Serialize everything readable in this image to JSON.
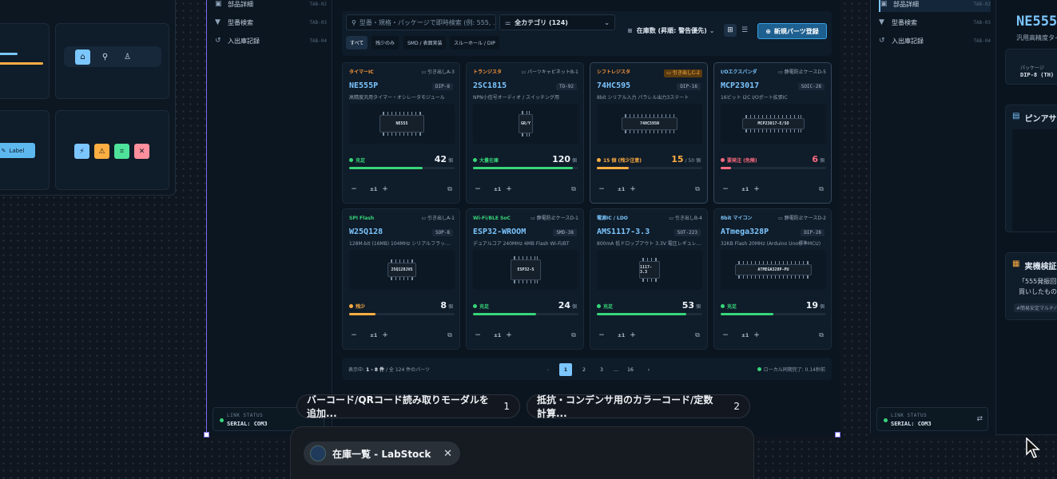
{
  "left_art": {
    "label_button": "Label"
  },
  "sidebar": {
    "items": [
      {
        "label": "部品詳細",
        "tag": "TAB-02"
      },
      {
        "label": "型番検索",
        "tag": "TAB-03"
      },
      {
        "label": "入出庫記録",
        "tag": "TAB-04"
      }
    ],
    "link_label": "LINK STATUS",
    "link_value": "SERIAL: COM3"
  },
  "toolbar": {
    "search_placeholder": "型番・規格・パッケージで即時検索 (例: 555, ...",
    "category": "全カテゴリ (124)",
    "chips": [
      "すべて",
      "残少のみ",
      "SMD / 表面実装",
      "スルーホール / DIP"
    ],
    "sort": "在庫数 (昇順: 警告優先)",
    "new_button": "新規パーツ登録"
  },
  "cards": [
    {
      "category": "タイマーIC",
      "cat_color": "#ff9a3c",
      "location": "引き出しA-3",
      "part": "NE555P",
      "package": "DIP-8",
      "desc": "高精度汎用タイマー・オシレータモジュール",
      "chip": "NE555",
      "status": "充足",
      "status_color": "#37d67a",
      "qty": "42",
      "max": "",
      "level": 0.7,
      "pm": "±1"
    },
    {
      "category": "トランジスタ",
      "cat_color": "#ff9a3c",
      "location": "パーツキャビネットB-1",
      "part": "2SC1815",
      "package": "TO-92",
      "desc": "NPN小信号オーディオ / スイッチング用",
      "chip": "GR/Y",
      "status": "大量在庫",
      "status_color": "#37d67a",
      "qty": "120",
      "max": "",
      "level": 0.95,
      "pm": "±1"
    },
    {
      "category": "シフトレジスタ",
      "cat_color": "#ff9a3c",
      "location": "引き出しC-2",
      "part": "74HC595",
      "package": "DIP-16",
      "desc": "8bit シリアル入力 パラレル出力3ステート",
      "chip": "74HC595N",
      "status": "15 個 (残少注意)",
      "status_color": "#ffae42",
      "qty": "15",
      "max": " / 50",
      "level": 0.3,
      "pm": "±1"
    },
    {
      "category": "I/Oエクスパンダ",
      "cat_color": "#7cc6ff",
      "location": "静電防止ケースD-5",
      "part": "MCP23017",
      "package": "SOIC-28",
      "desc": "16ビット I2C I/Oポート拡張IC",
      "chip": "MCP23017-E/SO",
      "status": "要発注 (危険)",
      "status_color": "#ff6b81",
      "qty": "6",
      "max": "",
      "level": 0.1,
      "pm": "±1"
    },
    {
      "category": "SPI Flash",
      "cat_color": "#37d67a",
      "location": "引き出しA-1",
      "part": "W25Q128",
      "package": "SOP-8",
      "desc": "128M-bit (16MB) 104MHz シリアルフラッシュ",
      "chip": "25Q128JVS",
      "status": "残少",
      "status_color": "#ffae42",
      "qty": "8",
      "max": "",
      "level": 0.25,
      "pm": "±1"
    },
    {
      "category": "Wi-Fi/BLE SoC",
      "cat_color": "#37d67a",
      "location": "静電防止ケースD-1",
      "part": "ESP32-WROOM",
      "package": "SMD-38",
      "desc": "デュアルコア 240MHz 4MB Flash Wi-Fi/BT",
      "chip": "ESP32-S",
      "status": "充足",
      "status_color": "#37d67a",
      "qty": "24",
      "max": "",
      "level": 0.6,
      "pm": "±1"
    },
    {
      "category": "電源IC / LDO",
      "cat_color": "#7cc6ff",
      "location": "引き出しB-4",
      "part": "AMS1117-3.3",
      "package": "SOT-223",
      "desc": "800mA 低ドロップアウト 3.3V 電圧レギュレータ",
      "chip": "1117-3.3",
      "status": "充足",
      "status_color": "#37d67a",
      "qty": "53",
      "max": "",
      "level": 0.85,
      "pm": "±1"
    },
    {
      "category": "8bit マイコン",
      "cat_color": "#7cc6ff",
      "location": "静電防止ケースD-2",
      "part": "ATmega328P",
      "package": "DIP-28",
      "desc": "32KB Flash 20MHz (Arduino Uno標準MCU)",
      "chip": "ATMEGA328P-PU",
      "status": "充足",
      "status_color": "#37d67a",
      "qty": "19",
      "max": "",
      "level": 0.5,
      "pm": "±1"
    }
  ],
  "pagination": {
    "prefix": "表示中:",
    "range": "1 - 8 件",
    "total": "/ 全 124 件のパーツ",
    "pages": [
      "1",
      "2",
      "3",
      "…",
      "16"
    ],
    "sync": "ローカル同期完了: 0.14秒前"
  },
  "right_art": {
    "items": [
      {
        "label": "部品詳細",
        "tag": "TAB-02"
      },
      {
        "label": "型番検索",
        "tag": "TAB-03"
      },
      {
        "label": "入出庫記録",
        "tag": "TAB-04"
      }
    ],
    "title": "NE555",
    "subtitle": "汎用高精度タイ",
    "package_label": "パッケージ",
    "package_value": "DIP-8 (TH)",
    "pinout_title": "ピンアサ",
    "notes_title": "実機検証",
    "notes_text1": "「555発振回",
    "notes_text2": "買いしたもの",
    "notes_tag": "#簡易安定マルチバ",
    "link_label": "LINK STATUS",
    "link_value": "SERIAL: COM3"
  },
  "suggestions": [
    {
      "text": "バーコード/QRコード読み取りモーダルを追加...",
      "num": "1"
    },
    {
      "text": "抵抗・コンデンサ用のカラーコード/定数計算...",
      "num": "2"
    }
  ],
  "browser_tab": {
    "title": "在庫一覧 - LabStock"
  }
}
